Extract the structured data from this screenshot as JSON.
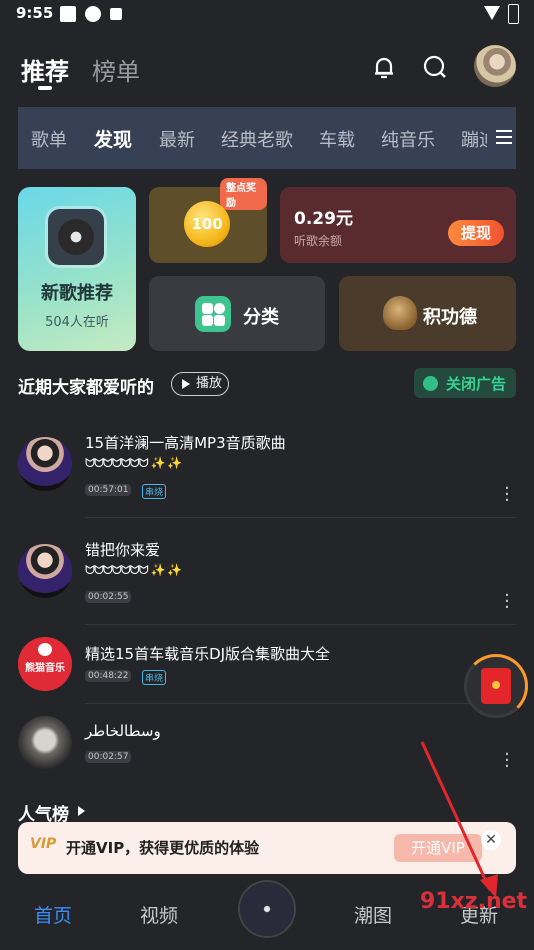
{
  "status_bar": {
    "time": "9:55"
  },
  "header": {
    "tabs": [
      {
        "label": "推荐"
      },
      {
        "label": "榜单"
      }
    ]
  },
  "categories": {
    "items": [
      "歌单",
      "发现",
      "最新",
      "经典老歌",
      "车载",
      "纯音乐",
      "蹦迪"
    ],
    "active_index": 1
  },
  "cards": {
    "new_songs": {
      "title": "新歌推荐",
      "listeners": "504人在听"
    },
    "coin": {
      "badge": "整点奖励",
      "amount": "100"
    },
    "balance": {
      "amount": "0.29元",
      "label": "听歌余额",
      "withdraw": "提现"
    },
    "category": {
      "label": "分类"
    },
    "merit": {
      "label": "积功德"
    }
  },
  "section": {
    "title": "近期大家都爱听的",
    "play": "播放",
    "close_ad": "关闭广告"
  },
  "tracks": [
    {
      "title": "15首洋澜一高清MP3音质歌曲",
      "title_line2": "ᗢᗢᗢᗢᗢᗢᗢ ✨ ✨",
      "duration": "00:57:01",
      "tag": "串烧"
    },
    {
      "title": "错把你来爱",
      "title_line2": "ᗢᗢᗢᗢᗢᗢᗢ ✨ ✨",
      "duration": "00:02:55",
      "tag": ""
    },
    {
      "title": "精选15首车载音乐DJ版合集歌曲大全",
      "title_line2": "",
      "duration": "00:48:22",
      "tag": "串烧",
      "avatar_text": "熊猫音乐"
    },
    {
      "title": "وسطالخاطر",
      "title_line2": "",
      "duration": "00:02:57",
      "tag": ""
    }
  ],
  "popular": {
    "title": "人气榜"
  },
  "vip_banner": {
    "logo": "VIP",
    "text": "开通VIP，获得更优质的体验",
    "button": "开通VIP",
    "close": "✕"
  },
  "bottom_nav": {
    "items": [
      "首页",
      "视频",
      "潮图",
      "更新"
    ],
    "active_index": 0
  },
  "watermark": {
    "text": "91xz.net"
  },
  "colors": {
    "accent": "#3c8ff6",
    "ad_green": "#38d394",
    "withdraw": "#f0532f"
  }
}
